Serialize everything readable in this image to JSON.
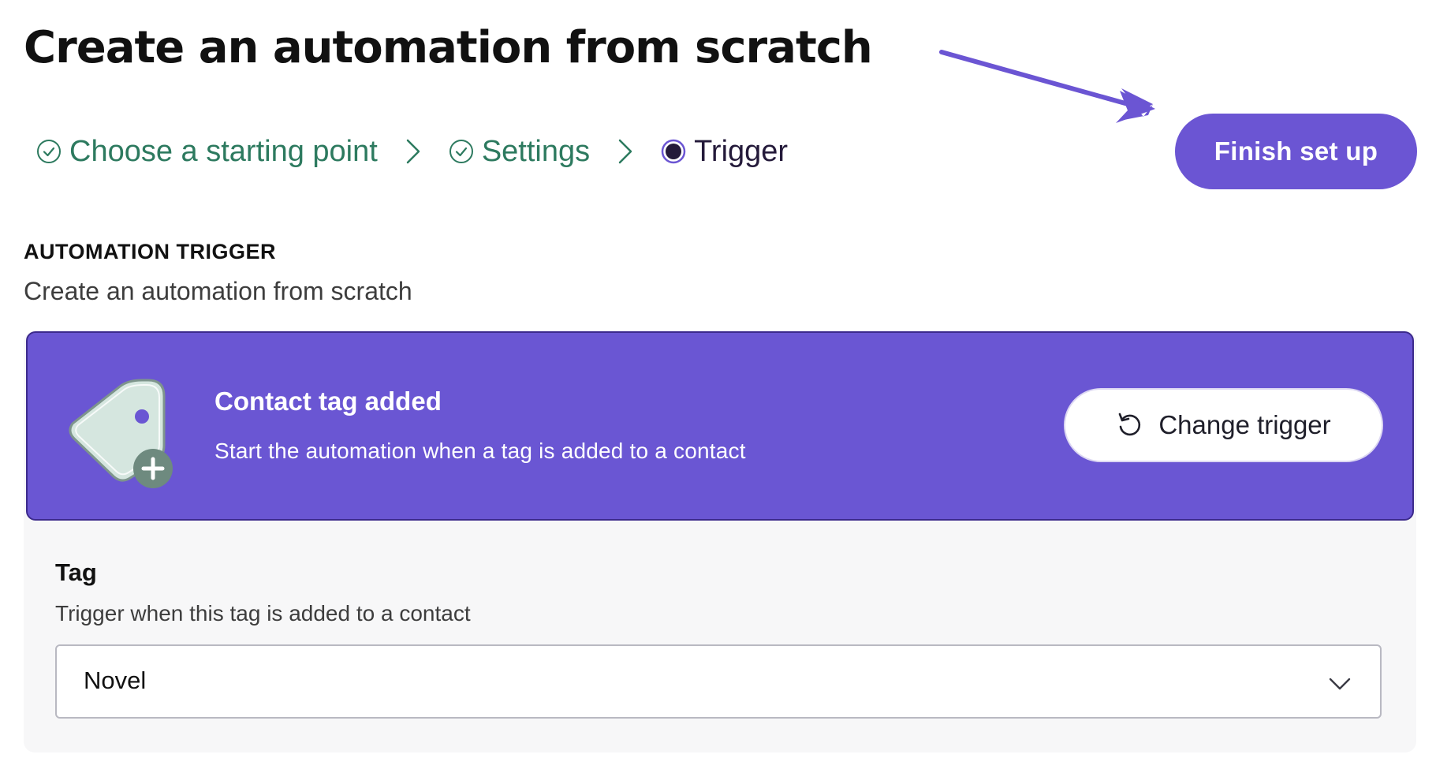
{
  "page": {
    "title": "Create an automation from scratch"
  },
  "stepper": {
    "steps": [
      {
        "label": "Choose a starting point",
        "status": "done"
      },
      {
        "label": "Settings",
        "status": "done"
      },
      {
        "label": "Trigger",
        "status": "current"
      }
    ]
  },
  "header": {
    "finish_label": "Finish set up"
  },
  "section": {
    "label": "AUTOMATION TRIGGER",
    "subtitle": "Create an automation from scratch"
  },
  "trigger": {
    "title": "Contact tag added",
    "description": "Start the automation when a tag is added to a contact",
    "change_label": "Change trigger",
    "icon": "tag-add-icon"
  },
  "tag_field": {
    "label": "Tag",
    "help": "Trigger when this tag is added to a contact",
    "value": "Novel"
  },
  "colors": {
    "accent": "#6b55d3",
    "done_step": "#2d7a5f",
    "current_step": "#241a3a",
    "panel_bg": "#f7f7f8"
  }
}
